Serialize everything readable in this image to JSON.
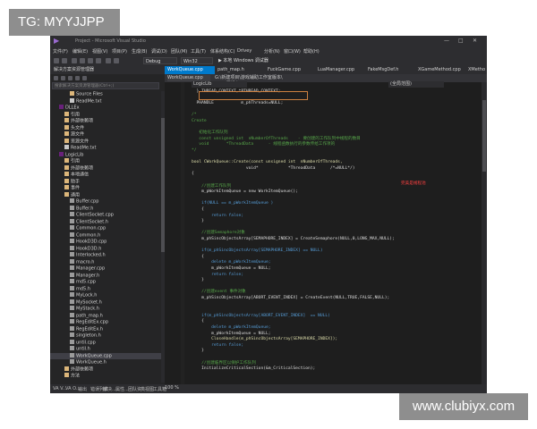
{
  "watermark_top": "TG: MYYJJPP",
  "watermark_bottom": "www.clubiyx.com",
  "window": {
    "title": "Project - Microsoft Visual Studio",
    "controls": [
      "—",
      "□",
      "✕"
    ]
  },
  "menu": [
    "文件(F)",
    "编辑(E)",
    "视图(V)",
    "项目(P)",
    "生成(B)",
    "调试(D)",
    "团队(M)",
    "工具(T)",
    "体系结构(C)",
    "Drivey",
    "分析(N)",
    "窗口(W)",
    "帮助(H)"
  ],
  "toolbar": {
    "config": "Debug",
    "platform": "Win32",
    "run": "▶ 本地 Windows 调试器"
  },
  "sidebar": {
    "title": "解决方案资源管理器",
    "search_placeholder": "搜索解决方案资源管理器(Ctrl+;)",
    "items": [
      {
        "label": "Source Files",
        "indent": 3,
        "icon": "folder-icon"
      },
      {
        "label": "ReadMe.txt",
        "indent": 3,
        "icon": "file-icon"
      },
      {
        "label": "DLLEx",
        "indent": 1,
        "icon": "project-icon",
        "bold": true
      },
      {
        "label": "引用",
        "indent": 2,
        "icon": "folder-icon"
      },
      {
        "label": "外部依赖项",
        "indent": 2,
        "icon": "folder-icon"
      },
      {
        "label": "头文件",
        "indent": 2,
        "icon": "folder-icon"
      },
      {
        "label": "源文件",
        "indent": 2,
        "icon": "folder-icon"
      },
      {
        "label": "资源文件",
        "indent": 2,
        "icon": "folder-icon"
      },
      {
        "label": "ReadMe.txt",
        "indent": 2,
        "icon": "file-icon"
      },
      {
        "label": "LogicLib",
        "indent": 1,
        "icon": "project-icon"
      },
      {
        "label": "引用",
        "indent": 2,
        "icon": "folder-icon"
      },
      {
        "label": "外部依赖项",
        "indent": 2,
        "icon": "folder-icon"
      },
      {
        "label": "本地通信",
        "indent": 2,
        "icon": "folder-icon"
      },
      {
        "label": "助手",
        "indent": 2,
        "icon": "folder-icon"
      },
      {
        "label": "事件",
        "indent": 2,
        "icon": "folder-icon"
      },
      {
        "label": "通用",
        "indent": 2,
        "icon": "folder-icon"
      },
      {
        "label": "Buffer.cpp",
        "indent": 3,
        "icon": "cpp-icon"
      },
      {
        "label": "Buffer.h",
        "indent": 3,
        "icon": "h-icon"
      },
      {
        "label": "ClientSocket.cpp",
        "indent": 3,
        "icon": "cpp-icon"
      },
      {
        "label": "ClientSocket.h",
        "indent": 3,
        "icon": "h-icon"
      },
      {
        "label": "Common.cpp",
        "indent": 3,
        "icon": "cpp-icon"
      },
      {
        "label": "Common.h",
        "indent": 3,
        "icon": "h-icon"
      },
      {
        "label": "HookD3D.cpp",
        "indent": 3,
        "icon": "cpp-icon"
      },
      {
        "label": "HookD3D.h",
        "indent": 3,
        "icon": "h-icon"
      },
      {
        "label": "Interlocked.h",
        "indent": 3,
        "icon": "h-icon"
      },
      {
        "label": "macro.h",
        "indent": 3,
        "icon": "h-icon"
      },
      {
        "label": "Manager.cpp",
        "indent": 3,
        "icon": "cpp-icon"
      },
      {
        "label": "Manager.h",
        "indent": 3,
        "icon": "h-icon"
      },
      {
        "label": "md5.cpp",
        "indent": 3,
        "icon": "cpp-icon"
      },
      {
        "label": "md5.h",
        "indent": 3,
        "icon": "h-icon"
      },
      {
        "label": "MyLock.h",
        "indent": 3,
        "icon": "h-icon"
      },
      {
        "label": "MySocket.h",
        "indent": 3,
        "icon": "h-icon"
      },
      {
        "label": "MyStack.h",
        "indent": 3,
        "icon": "h-icon"
      },
      {
        "label": "path_map.h",
        "indent": 3,
        "icon": "h-icon"
      },
      {
        "label": "RegEditEx.cpp",
        "indent": 3,
        "icon": "cpp-icon"
      },
      {
        "label": "RegEditEx.h",
        "indent": 3,
        "icon": "h-icon"
      },
      {
        "label": "singleton.h",
        "indent": 3,
        "icon": "h-icon"
      },
      {
        "label": "until.cpp",
        "indent": 3,
        "icon": "cpp-icon"
      },
      {
        "label": "until.h",
        "indent": 3,
        "icon": "h-icon"
      },
      {
        "label": "WorkQueue.cpp",
        "indent": 3,
        "icon": "cpp-icon",
        "selected": true
      },
      {
        "label": "WorkQueue.h",
        "indent": 3,
        "icon": "h-icon"
      },
      {
        "label": "外部依赖项",
        "indent": 2,
        "icon": "folder-icon"
      },
      {
        "label": "方法",
        "indent": 2,
        "icon": "folder-icon"
      }
    ]
  },
  "tabs": [
    "WorkQueue.cpp",
    "path_map.h",
    "FuckGame.cpp",
    "LuaManager.cpp",
    "FakeMsgDef.h",
    "XGameMethod.cpp",
    "XMetho"
  ],
  "path": {
    "file": "WorkQueue.cpp",
    "scope": "LogicLib",
    "location": "G:\\新建项目\\游戏辅助工作室版本\\(C)开源版本(V7)\\AsoframeWork\\Common\\WorkQueue.cpp",
    "member": "(全局范围)"
  },
  "code": [
    {
      "t": "  } THREAD_CONTEXT,*PTHREAD_CONTEXT;",
      "c": "c-id"
    },
    {
      "t": "",
      "c": "c-id"
    },
    {
      "t": "  PHANDLE           m_phThreads=NULL;",
      "c": "c-id"
    },
    {
      "t": "",
      "c": "c-id"
    },
    {
      "t": "/*",
      "c": "c-cm"
    },
    {
      "t": "Create",
      "c": "c-cm"
    },
    {
      "t": "",
      "c": "c-cm"
    },
    {
      "t": "   初始化工作队列",
      "c": "c-cm"
    },
    {
      "t": "   const unsigned int  nNumberOfThreads    - 要创建的工作队列中线程的数目",
      "c": "c-cm"
    },
    {
      "t": "   void       *ThreadData      - 线程函数执行的参数传给工作项的",
      "c": "c-cm"
    },
    {
      "t": "*/",
      "c": "c-cm"
    },
    {
      "t": "",
      "c": "c-id"
    },
    {
      "t": "bool CWorkQueue::Create(const unsigned int  nNumberOfThreads,",
      "c": "c-fn"
    },
    {
      "t": "                      void*            *ThreadData      /*=NULL*/)",
      "c": "c-id"
    },
    {
      "t": "{",
      "c": "c-id"
    },
    {
      "t": "",
      "c": "c-id"
    },
    {
      "t": "    //创建工作队列",
      "c": "c-cm"
    },
    {
      "t": "    m_pWorkItemQueue = new WorkItemQueue();",
      "c": "c-id"
    },
    {
      "t": "",
      "c": "c-id"
    },
    {
      "t": "    if(NULL == m_pWorkItemQueue )",
      "c": "c-kw"
    },
    {
      "t": "    {",
      "c": "c-id"
    },
    {
      "t": "        return false;",
      "c": "c-kw"
    },
    {
      "t": "    }",
      "c": "c-id"
    },
    {
      "t": "",
      "c": "c-id"
    },
    {
      "t": "    //创建Semaphore对象",
      "c": "c-cm"
    },
    {
      "t": "    m_phSincObjectsArray[SEMAPHORE_INDEX] = CreateSemaphore(NULL,0,LONG_MAX,NULL);",
      "c": "c-id"
    },
    {
      "t": "",
      "c": "c-id"
    },
    {
      "t": "    if(m_phSincObjectsArray[SEMAPHORE_INDEX] == NULL)",
      "c": "c-kw"
    },
    {
      "t": "    {",
      "c": "c-id"
    },
    {
      "t": "        delete m_pWorkItemQueue;",
      "c": "c-kw"
    },
    {
      "t": "        m_pWorkItemQueue = NULL;",
      "c": "c-id"
    },
    {
      "t": "        return false;",
      "c": "c-kw"
    },
    {
      "t": "    }",
      "c": "c-id"
    },
    {
      "t": "",
      "c": "c-id"
    },
    {
      "t": "    //创建event 事件对象",
      "c": "c-cm"
    },
    {
      "t": "    m_phSincObjectsArray[ABORT_EVENT_INDEX] = CreateEvent(NULL,TRUE,FALSE,NULL);",
      "c": "c-id"
    },
    {
      "t": "",
      "c": "c-id"
    },
    {
      "t": "",
      "c": "c-id"
    },
    {
      "t": "    if(m_phSincObjectsArray[ABORT_EVENT_INDEX]  == NULL)",
      "c": "c-kw"
    },
    {
      "t": "    {",
      "c": "c-id"
    },
    {
      "t": "        delete m_pWorkItemQueue;",
      "c": "c-kw"
    },
    {
      "t": "        m_pWorkItemQueue = NULL;",
      "c": "c-id"
    },
    {
      "t": "        CloseHandle(m_phSincObjectsArray[SEMAPHORE_INDEX]);",
      "c": "c-fn"
    },
    {
      "t": "        return false;",
      "c": "c-kw"
    },
    {
      "t": "    }",
      "c": "c-id"
    },
    {
      "t": "",
      "c": "c-id"
    },
    {
      "t": "    //创建临界区以保护工作队列",
      "c": "c-cm"
    },
    {
      "t": "    InitializeCriticalSection(&m_CriticalSection);",
      "c": "c-id"
    }
  ],
  "annotation": "完美是线程池",
  "zoom": "100 %",
  "status_tabs": [
    "VA V...",
    "VA O...",
    "输出",
    "错误列表",
    "解决...",
    "属性...",
    "团队资...",
    "类视图",
    "工具箱"
  ]
}
